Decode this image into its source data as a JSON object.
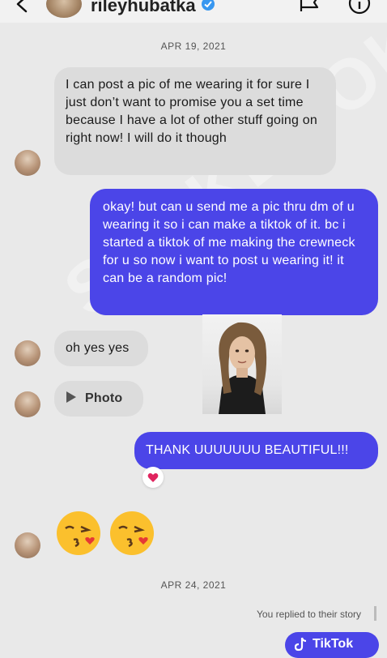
{
  "header": {
    "username": "rileyhubatka"
  },
  "dates": {
    "first": "APR 19, 2021",
    "second": "APR 24, 2021"
  },
  "messages": {
    "m1": "I can post a pic of me wearing it for sure I just don’t want to promise you a set time because I have a lot of other stuff going on right now! I will do it though",
    "m2": "okay! but can u send me a pic thru dm of u wearing it so i can make a tiktok of it. bc i started a tiktok of me making the crewneck for u so now i want to post u wearing it! it can be a random pic!",
    "m3": "oh yes yes",
    "m4": "Photo",
    "m5": "THANK UUUUUUU BEAUTIFUL!!!"
  },
  "story_reply_note": "You replied to their story",
  "watermark": "STOKBOOK",
  "tiktok_label": "TikTok",
  "colors": {
    "outgoing": "#4b45e8",
    "incoming": "#dcdcdc",
    "background": "#e9e9e9"
  },
  "icons": [
    "back-arrow-icon",
    "verified-icon",
    "flag-icon",
    "info-icon",
    "play-icon",
    "heart-icon",
    "kissing-face-icon",
    "tiktok-icon"
  ]
}
